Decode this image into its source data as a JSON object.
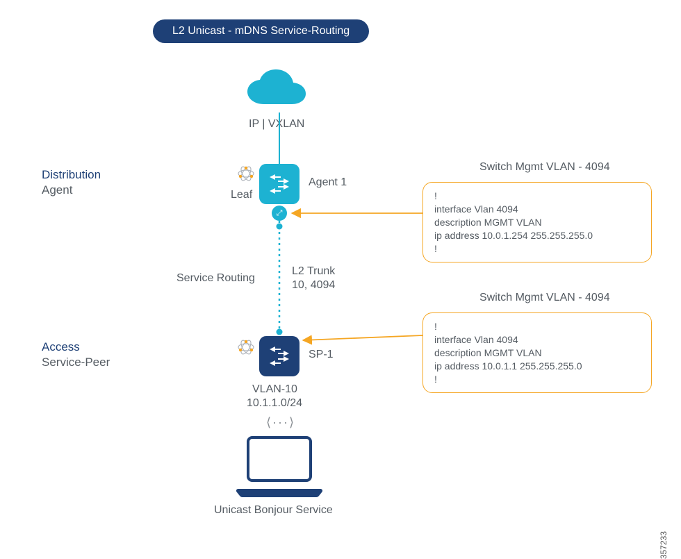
{
  "title_pill": "L2 Unicast - mDNS Service-Routing",
  "cloud_label": "IP | VXLAN",
  "distribution": {
    "heading": "Distribution",
    "role": "Agent"
  },
  "access": {
    "heading": "Access",
    "role": "Service-Peer"
  },
  "leaf_label": "Leaf",
  "agent1_label": "Agent 1",
  "sp1_label": "SP-1",
  "service_routing_label": "Service Routing",
  "l2trunk": {
    "line1": "L2 Trunk",
    "line2": "10, 4094"
  },
  "vlan": {
    "line1": "VLAN-10",
    "line2": "10.1.1.0/24"
  },
  "laptop_label": "Unicast Bonjour Service",
  "lr_symbol": "⟨···⟩",
  "callout1": {
    "heading": "Switch Mgmt VLAN - 4094",
    "l1": "!",
    "l2": "interface Vlan 4094",
    "l3": " description MGMT VLAN",
    "l4": " ip address 10.0.1.254 255.255.255.0",
    "l5": "!"
  },
  "callout2": {
    "heading": "Switch Mgmt VLAN - 4094",
    "l1": "!",
    "l2": "interface Vlan 4094",
    "l3": " description MGMT VLAN",
    "l4": " ip address 10.0.1.1 255.255.255.0",
    "l5": "!"
  },
  "image_id": "357233"
}
